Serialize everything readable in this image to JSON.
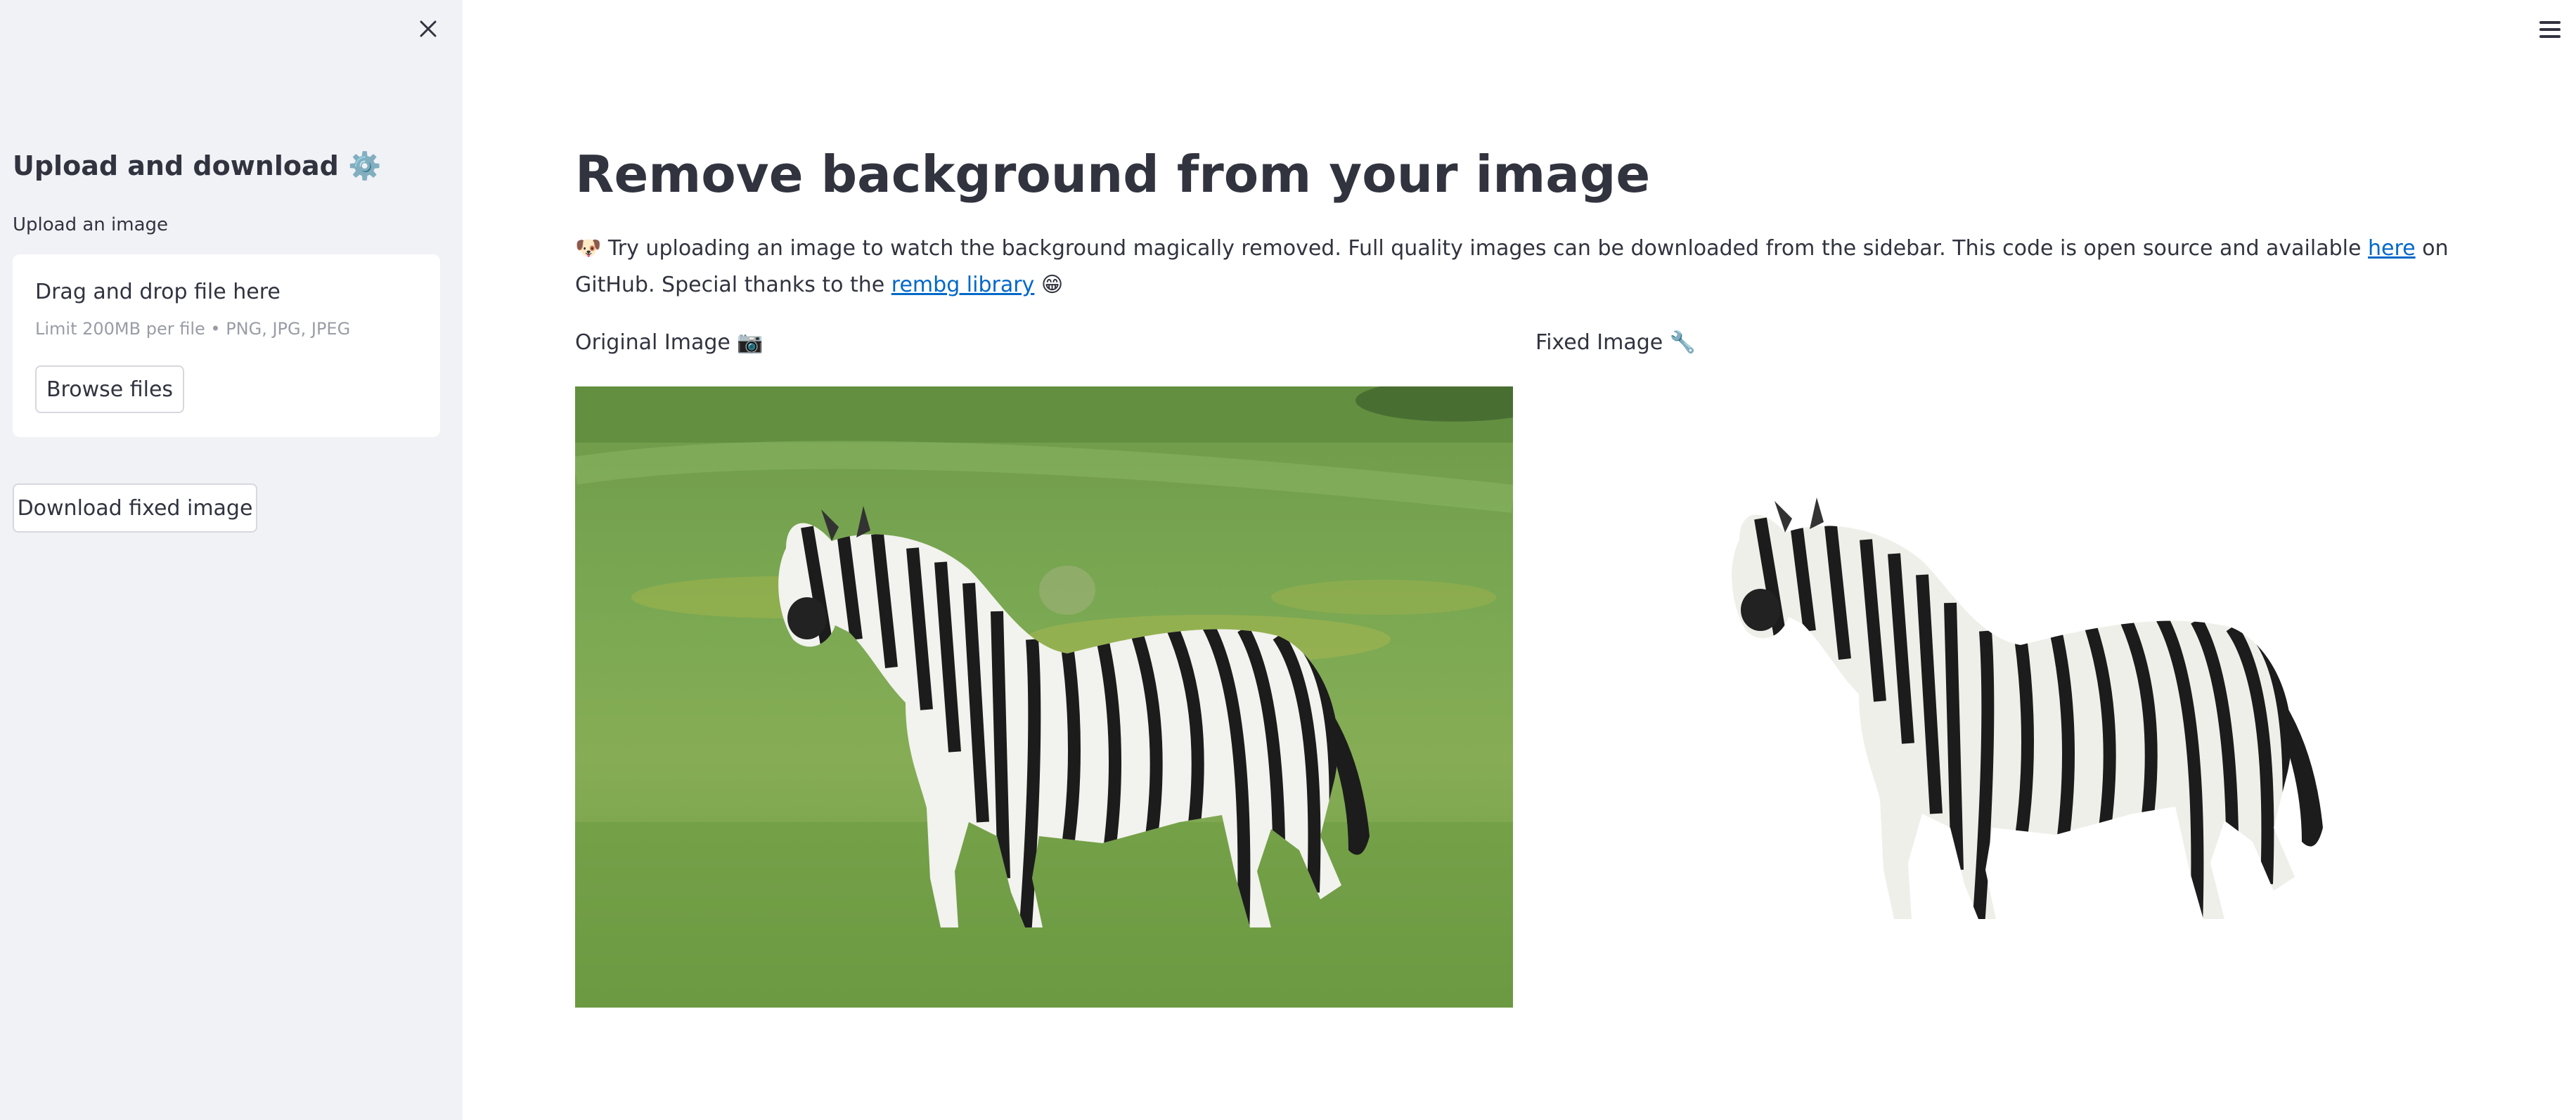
{
  "sidebar": {
    "heading": "Upload and download ⚙️",
    "upload_label": "Upload an image",
    "dropzone": {
      "title": "Drag and drop file here",
      "hint": "Limit 200MB per file • PNG, JPG, JPEG",
      "browse_label": "Browse files"
    },
    "download_label": "Download fixed image",
    "close_icon": "close-icon"
  },
  "header": {
    "menu_icon": "hamburger-menu-icon"
  },
  "main": {
    "title": "Remove background from your image",
    "intro": {
      "part1": "🐶 Try uploading an image to watch the background magically removed. Full quality images can be downloaded from the sidebar. This code is open source and available ",
      "link1": "here",
      "part2": " on GitHub. Special thanks to the ",
      "link2": "rembg library",
      "part3": " 😁"
    },
    "original_label": "Original Image 📷",
    "fixed_label": "Fixed Image 🔧"
  },
  "colors": {
    "sidebar_bg": "#f0f2f6",
    "text": "#31333f",
    "link": "#0068c9"
  }
}
